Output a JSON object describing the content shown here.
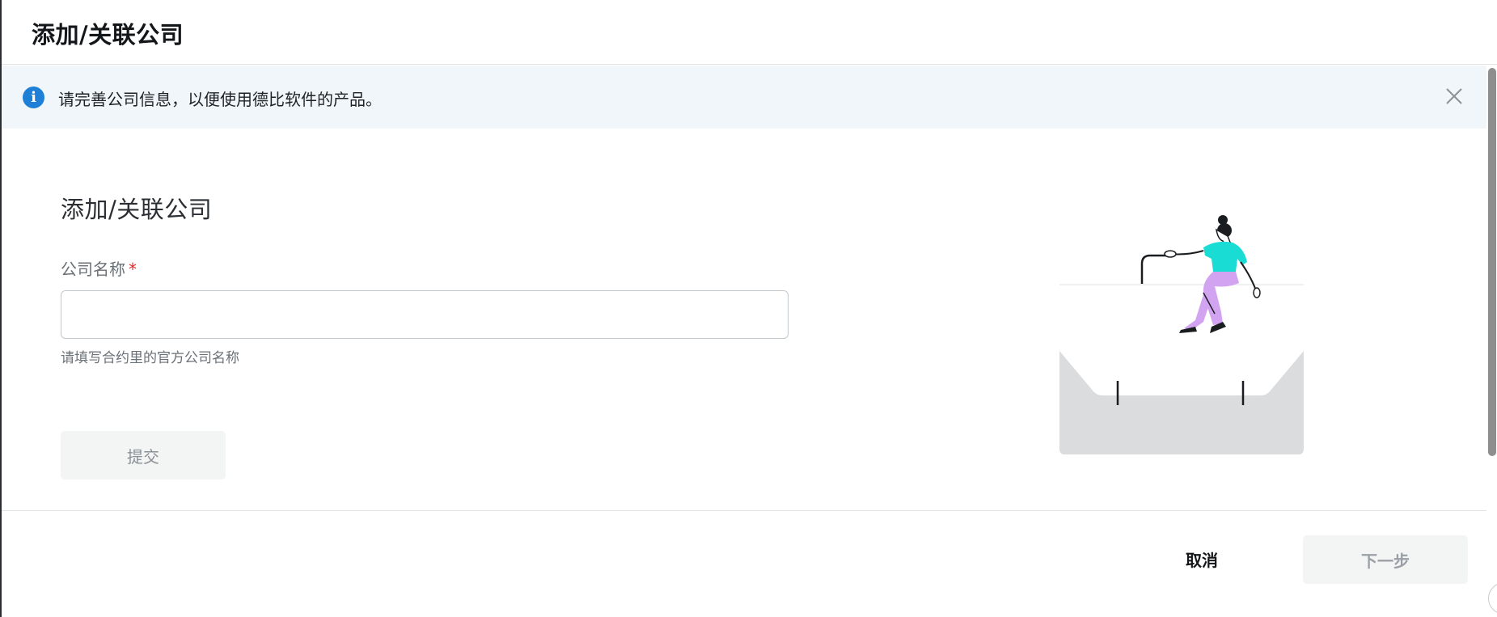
{
  "modal": {
    "title": "添加/关联公司"
  },
  "notice": {
    "icon": "info-icon",
    "icon_glyph": "i",
    "text": "请完善公司信息，以便使用德比软件的产品。",
    "close_icon": "close-icon"
  },
  "form": {
    "title": "添加/关联公司",
    "company_name": {
      "label": "公司名称",
      "required_mark": "*",
      "value": "",
      "help": "请填写合约里的官方公司名称"
    },
    "submit_label": "提交"
  },
  "footer": {
    "cancel_label": "取消",
    "next_label": "下一步"
  },
  "colors": {
    "info_blue": "#1e7fd6",
    "notice_bg": "#f1f6fa",
    "required_red": "#e02929",
    "disabled_bg": "#f3f5f5",
    "illustration_teal": "#19dcd4",
    "illustration_purple": "#d2a3f0"
  }
}
